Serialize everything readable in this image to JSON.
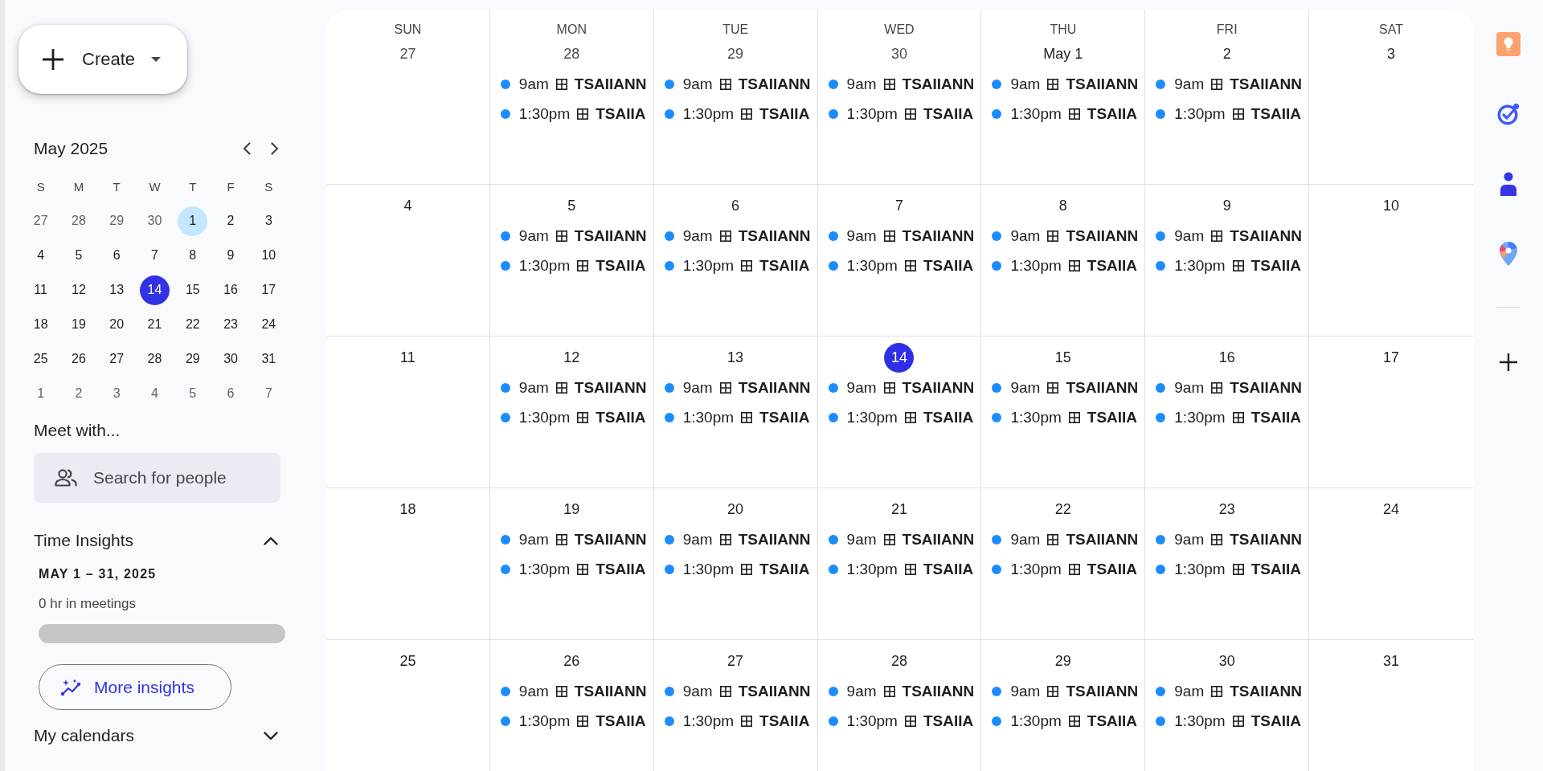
{
  "create_button": {
    "label": "Create"
  },
  "mini_calendar": {
    "title": "May 2025",
    "weekdays": [
      "S",
      "M",
      "T",
      "W",
      "T",
      "F",
      "S"
    ],
    "weeks": [
      [
        {
          "label": "27",
          "outside_month": true,
          "today": false,
          "selected": false
        },
        {
          "label": "28",
          "outside_month": true,
          "today": false,
          "selected": false
        },
        {
          "label": "29",
          "outside_month": true,
          "today": false,
          "selected": false
        },
        {
          "label": "30",
          "outside_month": true,
          "today": false,
          "selected": false
        },
        {
          "label": "1",
          "outside_month": false,
          "today": false,
          "selected": true
        },
        {
          "label": "2",
          "outside_month": false,
          "today": false,
          "selected": false
        },
        {
          "label": "3",
          "outside_month": false,
          "today": false,
          "selected": false
        }
      ],
      [
        {
          "label": "4",
          "outside_month": false,
          "today": false,
          "selected": false
        },
        {
          "label": "5",
          "outside_month": false,
          "today": false,
          "selected": false
        },
        {
          "label": "6",
          "outside_month": false,
          "today": false,
          "selected": false
        },
        {
          "label": "7",
          "outside_month": false,
          "today": false,
          "selected": false
        },
        {
          "label": "8",
          "outside_month": false,
          "today": false,
          "selected": false
        },
        {
          "label": "9",
          "outside_month": false,
          "today": false,
          "selected": false
        },
        {
          "label": "10",
          "outside_month": false,
          "today": false,
          "selected": false
        }
      ],
      [
        {
          "label": "11",
          "outside_month": false,
          "today": false,
          "selected": false
        },
        {
          "label": "12",
          "outside_month": false,
          "today": false,
          "selected": false
        },
        {
          "label": "13",
          "outside_month": false,
          "today": false,
          "selected": false
        },
        {
          "label": "14",
          "outside_month": false,
          "today": true,
          "selected": false
        },
        {
          "label": "15",
          "outside_month": false,
          "today": false,
          "selected": false
        },
        {
          "label": "16",
          "outside_month": false,
          "today": false,
          "selected": false
        },
        {
          "label": "17",
          "outside_month": false,
          "today": false,
          "selected": false
        }
      ],
      [
        {
          "label": "18",
          "outside_month": false,
          "today": false,
          "selected": false
        },
        {
          "label": "19",
          "outside_month": false,
          "today": false,
          "selected": false
        },
        {
          "label": "20",
          "outside_month": false,
          "today": false,
          "selected": false
        },
        {
          "label": "21",
          "outside_month": false,
          "today": false,
          "selected": false
        },
        {
          "label": "22",
          "outside_month": false,
          "today": false,
          "selected": false
        },
        {
          "label": "23",
          "outside_month": false,
          "today": false,
          "selected": false
        },
        {
          "label": "24",
          "outside_month": false,
          "today": false,
          "selected": false
        }
      ],
      [
        {
          "label": "25",
          "outside_month": false,
          "today": false,
          "selected": false
        },
        {
          "label": "26",
          "outside_month": false,
          "today": false,
          "selected": false
        },
        {
          "label": "27",
          "outside_month": false,
          "today": false,
          "selected": false
        },
        {
          "label": "28",
          "outside_month": false,
          "today": false,
          "selected": false
        },
        {
          "label": "29",
          "outside_month": false,
          "today": false,
          "selected": false
        },
        {
          "label": "30",
          "outside_month": false,
          "today": false,
          "selected": false
        },
        {
          "label": "31",
          "outside_month": false,
          "today": false,
          "selected": false
        }
      ],
      [
        {
          "label": "1",
          "outside_month": true,
          "today": false,
          "selected": false
        },
        {
          "label": "2",
          "outside_month": true,
          "today": false,
          "selected": false
        },
        {
          "label": "3",
          "outside_month": true,
          "today": false,
          "selected": false
        },
        {
          "label": "4",
          "outside_month": true,
          "today": false,
          "selected": false
        },
        {
          "label": "5",
          "outside_month": true,
          "today": false,
          "selected": false
        },
        {
          "label": "6",
          "outside_month": true,
          "today": false,
          "selected": false
        },
        {
          "label": "7",
          "outside_month": true,
          "today": false,
          "selected": false
        }
      ]
    ]
  },
  "meet_with": {
    "title": "Meet with...",
    "search": {
      "placeholder": "Search for people"
    }
  },
  "time_insights": {
    "title": "Time Insights",
    "expanded": true,
    "range": "MAY 1 – 31, 2025",
    "summary": "0 hr in meetings",
    "button": "More insights"
  },
  "my_calendars": {
    "title": "My calendars",
    "expanded": false
  },
  "calendar": {
    "weekdays": [
      "SUN",
      "MON",
      "TUE",
      "WED",
      "THU",
      "FRI",
      "SAT"
    ],
    "weeks": [
      [
        {
          "date": "27",
          "outside_month": true,
          "today": false
        },
        {
          "date": "28",
          "outside_month": true,
          "today": false,
          "events": [
            {
              "time": "9am",
              "title": "TSAIIANN"
            },
            {
              "time": "1:30pm",
              "title": "TSAIIA"
            }
          ]
        },
        {
          "date": "29",
          "outside_month": true,
          "today": false,
          "events": [
            {
              "time": "9am",
              "title": "TSAIIANN"
            },
            {
              "time": "1:30pm",
              "title": "TSAIIA"
            }
          ]
        },
        {
          "date": "30",
          "outside_month": true,
          "today": false,
          "events": [
            {
              "time": "9am",
              "title": "TSAIIANN"
            },
            {
              "time": "1:30pm",
              "title": "TSAIIA"
            }
          ]
        },
        {
          "date": "May 1",
          "outside_month": false,
          "today": false,
          "events": [
            {
              "time": "9am",
              "title": "TSAIIANN"
            },
            {
              "time": "1:30pm",
              "title": "TSAIIA"
            }
          ]
        },
        {
          "date": "2",
          "outside_month": false,
          "today": false,
          "events": [
            {
              "time": "9am",
              "title": "TSAIIANN"
            },
            {
              "time": "1:30pm",
              "title": "TSAIIA"
            }
          ]
        },
        {
          "date": "3",
          "outside_month": false,
          "today": false
        }
      ],
      [
        {
          "date": "4",
          "outside_month": false,
          "today": false
        },
        {
          "date": "5",
          "outside_month": false,
          "today": false,
          "events": [
            {
              "time": "9am",
              "title": "TSAIIANN"
            },
            {
              "time": "1:30pm",
              "title": "TSAIIA"
            }
          ]
        },
        {
          "date": "6",
          "outside_month": false,
          "today": false,
          "events": [
            {
              "time": "9am",
              "title": "TSAIIANN"
            },
            {
              "time": "1:30pm",
              "title": "TSAIIA"
            }
          ]
        },
        {
          "date": "7",
          "outside_month": false,
          "today": false,
          "events": [
            {
              "time": "9am",
              "title": "TSAIIANN"
            },
            {
              "time": "1:30pm",
              "title": "TSAIIA"
            }
          ]
        },
        {
          "date": "8",
          "outside_month": false,
          "today": false,
          "events": [
            {
              "time": "9am",
              "title": "TSAIIANN"
            },
            {
              "time": "1:30pm",
              "title": "TSAIIA"
            }
          ]
        },
        {
          "date": "9",
          "outside_month": false,
          "today": false,
          "events": [
            {
              "time": "9am",
              "title": "TSAIIANN"
            },
            {
              "time": "1:30pm",
              "title": "TSAIIA"
            }
          ]
        },
        {
          "date": "10",
          "outside_month": false,
          "today": false
        }
      ],
      [
        {
          "date": "11",
          "outside_month": false,
          "today": false
        },
        {
          "date": "12",
          "outside_month": false,
          "today": false,
          "events": [
            {
              "time": "9am",
              "title": "TSAIIANN"
            },
            {
              "time": "1:30pm",
              "title": "TSAIIA"
            }
          ]
        },
        {
          "date": "13",
          "outside_month": false,
          "today": false,
          "events": [
            {
              "time": "9am",
              "title": "TSAIIANN"
            },
            {
              "time": "1:30pm",
              "title": "TSAIIA"
            }
          ]
        },
        {
          "date": "14",
          "outside_month": false,
          "today": true,
          "events": [
            {
              "time": "9am",
              "title": "TSAIIANN"
            },
            {
              "time": "1:30pm",
              "title": "TSAIIA"
            }
          ]
        },
        {
          "date": "15",
          "outside_month": false,
          "today": false,
          "events": [
            {
              "time": "9am",
              "title": "TSAIIANN"
            },
            {
              "time": "1:30pm",
              "title": "TSAIIA"
            }
          ]
        },
        {
          "date": "16",
          "outside_month": false,
          "today": false,
          "events": [
            {
              "time": "9am",
              "title": "TSAIIANN"
            },
            {
              "time": "1:30pm",
              "title": "TSAIIA"
            }
          ]
        },
        {
          "date": "17",
          "outside_month": false,
          "today": false
        }
      ],
      [
        {
          "date": "18",
          "outside_month": false,
          "today": false
        },
        {
          "date": "19",
          "outside_month": false,
          "today": false,
          "events": [
            {
              "time": "9am",
              "title": "TSAIIANN"
            },
            {
              "time": "1:30pm",
              "title": "TSAIIA"
            }
          ]
        },
        {
          "date": "20",
          "outside_month": false,
          "today": false,
          "events": [
            {
              "time": "9am",
              "title": "TSAIIANN"
            },
            {
              "time": "1:30pm",
              "title": "TSAIIA"
            }
          ]
        },
        {
          "date": "21",
          "outside_month": false,
          "today": false,
          "events": [
            {
              "time": "9am",
              "title": "TSAIIANN"
            },
            {
              "time": "1:30pm",
              "title": "TSAIIA"
            }
          ]
        },
        {
          "date": "22",
          "outside_month": false,
          "today": false,
          "events": [
            {
              "time": "9am",
              "title": "TSAIIANN"
            },
            {
              "time": "1:30pm",
              "title": "TSAIIA"
            }
          ]
        },
        {
          "date": "23",
          "outside_month": false,
          "today": false,
          "events": [
            {
              "time": "9am",
              "title": "TSAIIANN"
            },
            {
              "time": "1:30pm",
              "title": "TSAIIA"
            }
          ]
        },
        {
          "date": "24",
          "outside_month": false,
          "today": false
        }
      ],
      [
        {
          "date": "25",
          "outside_month": false,
          "today": false
        },
        {
          "date": "26",
          "outside_month": false,
          "today": false,
          "events": [
            {
              "time": "9am",
              "title": "TSAIIANN"
            },
            {
              "time": "1:30pm",
              "title": "TSAIIA"
            }
          ]
        },
        {
          "date": "27",
          "outside_month": false,
          "today": false,
          "events": [
            {
              "time": "9am",
              "title": "TSAIIANN"
            },
            {
              "time": "1:30pm",
              "title": "TSAIIA"
            }
          ]
        },
        {
          "date": "28",
          "outside_month": false,
          "today": false,
          "events": [
            {
              "time": "9am",
              "title": "TSAIIANN"
            },
            {
              "time": "1:30pm",
              "title": "TSAIIA"
            }
          ]
        },
        {
          "date": "29",
          "outside_month": false,
          "today": false,
          "events": [
            {
              "time": "9am",
              "title": "TSAIIANN"
            },
            {
              "time": "1:30pm",
              "title": "TSAIIA"
            }
          ]
        },
        {
          "date": "30",
          "outside_month": false,
          "today": false,
          "events": [
            {
              "time": "9am",
              "title": "TSAIIANN"
            },
            {
              "time": "1:30pm",
              "title": "TSAIIA"
            }
          ]
        },
        {
          "date": "31",
          "outside_month": false,
          "today": false
        }
      ]
    ]
  }
}
